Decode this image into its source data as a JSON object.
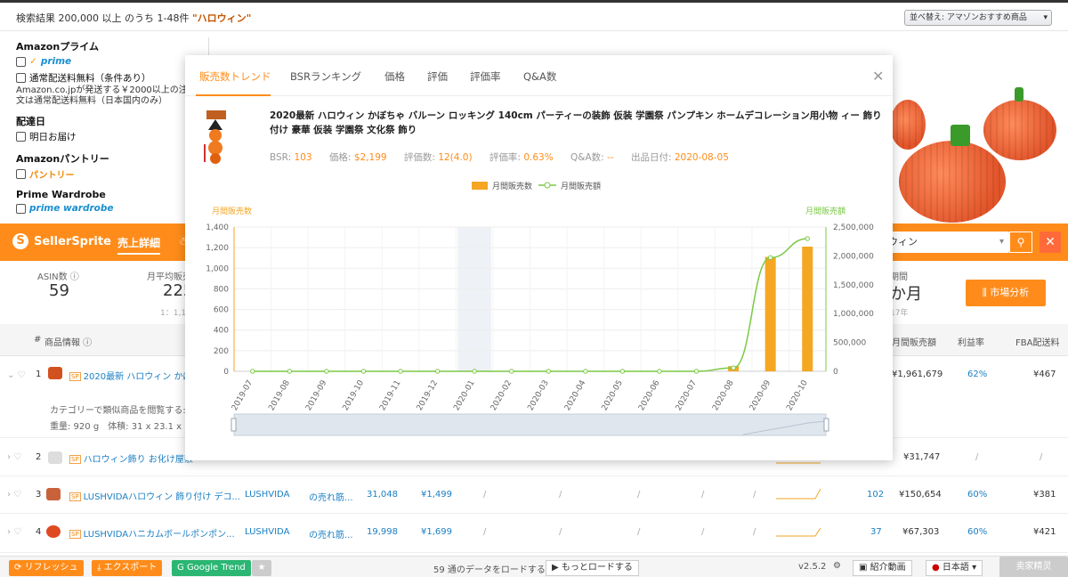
{
  "search": {
    "result_prefix": "検索結果 200,000 以上 のうち 1-48件",
    "query": "\"ハロウィン\"",
    "sort_label": "並べ替え: アマゾンおすすめ商品"
  },
  "sidebar": {
    "prime_heading": "Amazonプライム",
    "prime_label": "prime",
    "free_shipping": "通常配送料無料（条件あり）",
    "amazon_ship_1": "Amazon.co.jpが発送する￥2000以上の注",
    "amazon_ship_2": "文は通常配送料無料（日本国内のみ）",
    "delivery_heading": "配達日",
    "tomorrow": "明日お届け",
    "pantry_heading": "Amazonパントリー",
    "pantry_label": "パントリー",
    "wardrobe_heading": "Prime Wardrobe",
    "wardrobe_label": "prime wardrobe"
  },
  "sellersprite": {
    "logo": "SellerSprite",
    "tab_active": "売上詳細",
    "tab_next": "☃",
    "search_value": "ウィン",
    "search_icon": "search-icon",
    "close_icon": "close-icon",
    "asin_label": "ASIN数",
    "asin_value": "59",
    "avg_label": "月平均販売",
    "avg_value": "225",
    "avg_sub": "1：1,1",
    "period_label": "期間",
    "period_value": "か月",
    "period_sub": "17年",
    "market_button": "市場分析"
  },
  "table": {
    "headers": [
      "#",
      "商品情報",
      "月間販売額",
      "利益率",
      "FBA配送料"
    ],
    "rows": [
      {
        "num": "1",
        "title": "2020最新 ハロウィン かぼ",
        "sales": "¥1,961,679",
        "margin": "62%",
        "fba": "¥467"
      },
      {
        "num": "2",
        "title": "ハロウィン飾り お化け屋敷",
        "sales": "¥31,747",
        "margin": "/",
        "fba": "/"
      },
      {
        "num": "3",
        "title": "LUSHVIDAハロウィン 飾り付け デコ...",
        "brand": "LUSHVIDA",
        "cat": "の売れ筋...",
        "rank": "31,048",
        "price": "¥1,499",
        "reviews": "102",
        "sales": "¥150,654",
        "margin": "60%",
        "fba": "¥381"
      },
      {
        "num": "4",
        "title": "LUSHVIDAハニカムボールポンポン...",
        "brand": "LUSHVIDA",
        "cat": "の売れ筋...",
        "rank": "19,998",
        "price": "¥1,699",
        "reviews": "37",
        "sales": "¥67,303",
        "margin": "60%",
        "fba": "¥421"
      }
    ],
    "expand_text": "カテゴリーで類似商品を閲覧する: ",
    "weight_text": "重量: 920 g　体積: 31 x 23.1 x 7.8 c"
  },
  "bottom": {
    "refresh": "リフレッシュ",
    "export": "エクスポート",
    "google_trend": "Google Trend",
    "loaded": "59 通のデータをロードする",
    "load_more": "もっとロードする",
    "version": "v2.5.2",
    "intro_video": "紹介動画",
    "language": "日本語",
    "seller": "卖家精灵"
  },
  "modal": {
    "tabs": [
      "販売数トレンド",
      "BSRランキング",
      "価格",
      "評価",
      "評価率",
      "Q&A数"
    ],
    "close_icon": "close-icon",
    "product_title": "2020最新 ハロウィン かぼちゃ バルーン ロッキング 140cm パーティーの装飾 仮装 学園祭 パンプキン ホームデコレーション用小物 ィー 飾り付け 豪華 仮装 学園祭 文化祭 飾り",
    "bsr_label": "BSR:",
    "bsr_value": "103",
    "price_label": "価格:",
    "price_value": "$2,199",
    "reviews_label": "評価数:",
    "reviews_value": "12(4.0)",
    "rating_label": "評価率:",
    "rating_value": "0.63%",
    "qa_label": "Q&A数:",
    "qa_value": "--",
    "date_label": "出品日付:",
    "date_value": "2020-08-05"
  },
  "colors": {
    "accent": "#ff8c1a",
    "line": "#7ac943",
    "link": "#1a7fc4"
  },
  "chart_data": {
    "type": "bar",
    "categories": [
      "2019-07",
      "2019-08",
      "2019-09",
      "2019-10",
      "2019-11",
      "2019-12",
      "2020-01",
      "2020-02",
      "2020-03",
      "2020-04",
      "2020-05",
      "2020-06",
      "2020-07",
      "2020-08",
      "2020-09",
      "2020-10"
    ],
    "series": [
      {
        "name": "月間販売数",
        "type": "bar",
        "axis": "left",
        "color": "#f5a623",
        "values": [
          0,
          0,
          0,
          0,
          0,
          0,
          0,
          0,
          0,
          0,
          0,
          0,
          0,
          50,
          1110,
          1210
        ]
      },
      {
        "name": "月間販売額",
        "type": "line",
        "axis": "right",
        "color": "#7ac943",
        "values": [
          0,
          0,
          0,
          0,
          0,
          0,
          0,
          0,
          0,
          0,
          0,
          0,
          0,
          60000,
          1970000,
          2300000
        ]
      }
    ],
    "ylabel_left": "月間販売数",
    "ylabel_right": "月間販売額",
    "ylim_left": [
      0,
      1400
    ],
    "ylim_right": [
      0,
      2500000
    ],
    "yticks_left": [
      "0",
      "200",
      "400",
      "600",
      "800",
      "1,000",
      "1,200",
      "1,400"
    ],
    "yticks_right": [
      "0",
      "500,000",
      "1,000,000",
      "1,500,000",
      "2,000,000",
      "2,500,000"
    ],
    "highlight_category": "2020-01",
    "legend_position": "top-center",
    "grid": true
  }
}
